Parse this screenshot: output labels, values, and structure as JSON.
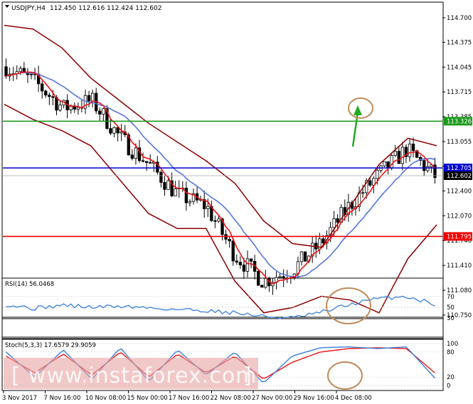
{
  "header": {
    "symbol_timeframe": "USDJPY,H4",
    "ohlc": "112.450 112.616 112.424 112.602"
  },
  "main_panel": {
    "y_ticks": [
      "114.700",
      "114.375",
      "114.045",
      "113.715",
      "113.385",
      "113.055",
      "112.725",
      "112.400",
      "112.070",
      "111.740",
      "111.410",
      "111.080",
      "110.750"
    ],
    "ylim": [
      110.75,
      114.7
    ],
    "levels": [
      {
        "name": "resistance",
        "value": 113.326,
        "label": "113.326",
        "color": "#1a9a1a"
      },
      {
        "name": "pivot",
        "value": 112.705,
        "label": "112.705",
        "color": "#0000cc"
      },
      {
        "name": "support",
        "value": 111.795,
        "label": "111.795",
        "color": "#ee0000"
      }
    ],
    "current_price": {
      "value": 112.602,
      "label": "112.602"
    },
    "arrow_color": "#22aa22",
    "circle_color": "#c08a5a"
  },
  "chart_data": [
    {
      "type": "line",
      "title": "USDJPY,H4",
      "x": [
        "3 Nov 2017",
        "7 Nov 16:00",
        "10 Nov 08:00",
        "15 Nov 00:00",
        "17 Nov 16:00",
        "22 Nov 08:00",
        "27 Nov 00:00",
        "29 Nov 16:00",
        "4 Dec 08:00"
      ],
      "ylim": [
        110.75,
        114.7
      ],
      "series": [
        {
          "name": "close",
          "values": [
            114.05,
            113.85,
            113.5,
            113.6,
            113.1,
            112.75,
            112.35,
            112.2,
            111.55,
            111.2,
            111.35,
            111.7,
            112.2,
            112.6,
            112.95,
            112.6
          ]
        },
        {
          "name": "bb_upper",
          "values": [
            114.6,
            114.55,
            114.3,
            113.9,
            113.6,
            113.3,
            113.05,
            112.8,
            112.5,
            112.0,
            111.7,
            111.65,
            112.2,
            112.75,
            113.1,
            113.0
          ]
        },
        {
          "name": "bb_lower",
          "values": [
            113.55,
            113.35,
            113.2,
            113.0,
            112.55,
            112.1,
            111.9,
            111.9,
            111.2,
            110.78,
            110.85,
            111.0,
            110.95,
            110.78,
            111.5,
            111.95
          ]
        }
      ]
    },
    {
      "type": "line",
      "title": "RSI(14) 56.0468",
      "ylim": [
        0,
        100
      ],
      "levels": [
        70,
        50,
        30
      ],
      "series": [
        {
          "name": "RSI(14)",
          "values": [
            55,
            48,
            54,
            50,
            52,
            49,
            46,
            44,
            40,
            33,
            30,
            40,
            55,
            66,
            70,
            56
          ]
        }
      ]
    },
    {
      "type": "line",
      "title": "Stoch(5,3,3) 17.6579 29.9059",
      "ylim": [
        0,
        100
      ],
      "levels": [
        80,
        20
      ],
      "series": [
        {
          "name": "main",
          "values": [
            80,
            20,
            85,
            15,
            90,
            10,
            85,
            25,
            80,
            5,
            70,
            90,
            92,
            88,
            92,
            17.66
          ]
        },
        {
          "name": "signal",
          "values": [
            70,
            30,
            75,
            25,
            80,
            20,
            75,
            30,
            70,
            15,
            55,
            80,
            88,
            90,
            88,
            29.91
          ]
        }
      ]
    }
  ],
  "rsi_panel": {
    "label": "RSI(14) 56.0468",
    "y_ticks": [
      "70",
      "50",
      "30"
    ]
  },
  "stoch_panel": {
    "label": "Stoch(5,3,3) 17.6579 29.9059",
    "y_ticks": [
      "100",
      "80",
      "20",
      "0"
    ]
  },
  "x_axis": {
    "labels": [
      "3 Nov 2017",
      "7 Nov 16:00",
      "10 Nov 08:00",
      "15 Nov 00:00",
      "17 Nov 16:00",
      "22 Nov 08:00",
      "27 Nov 00:00",
      "29 Nov 16:00",
      "4 Dec 08:00"
    ]
  },
  "watermark": {
    "text": "www.instaforex.com"
  }
}
